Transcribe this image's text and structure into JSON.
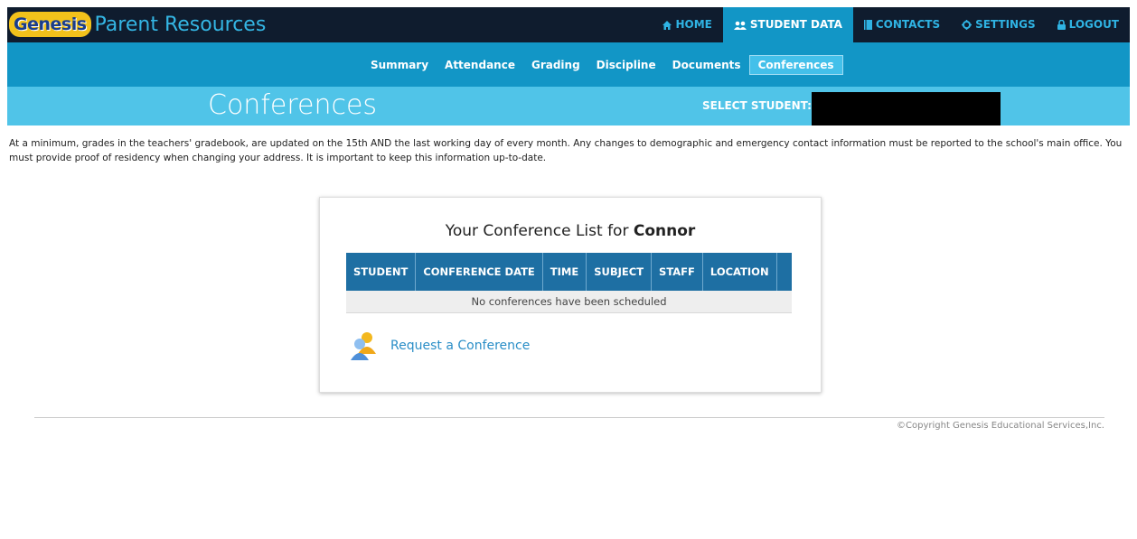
{
  "header": {
    "logo_text": "Genesis",
    "app_title": "Parent Resources",
    "nav": [
      {
        "label": "HOME",
        "icon": "home-icon"
      },
      {
        "label": "STUDENT DATA",
        "icon": "users-icon",
        "active": true
      },
      {
        "label": "CONTACTS",
        "icon": "book-icon"
      },
      {
        "label": "SETTINGS",
        "icon": "gear-icon"
      },
      {
        "label": "LOGOUT",
        "icon": "lock-icon"
      }
    ]
  },
  "subnav": {
    "items": [
      {
        "label": "Summary"
      },
      {
        "label": "Attendance"
      },
      {
        "label": "Grading"
      },
      {
        "label": "Discipline"
      },
      {
        "label": "Documents"
      },
      {
        "label": "Conferences",
        "active": true
      }
    ]
  },
  "page": {
    "title": "Conferences",
    "select_student_label": "SELECT STUDENT:"
  },
  "notice": "At a minimum, grades in the teachers' gradebook, are updated on the 15th AND the last working day of every month. Any changes to demographic and emergency contact information must be reported to the school's main office. You must provide proof of residency when changing your address. It is important to keep this information up-to-date.",
  "conference": {
    "heading_prefix": "Your Conference List for",
    "student_name": "Connor",
    "columns": [
      "STUDENT",
      "CONFERENCE DATE",
      "TIME",
      "SUBJECT",
      "STAFF",
      "LOCATION",
      ""
    ],
    "empty_message": "No conferences have been scheduled",
    "request_label": "Request a Conference"
  },
  "footer": {
    "copyright": "©Copyright Genesis Educational Services,Inc."
  },
  "colors": {
    "topbar": "#0f1c2e",
    "subnav": "#1296c6",
    "band": "#50c4e8",
    "table_header": "#1e6fa3",
    "link": "#2a8ec7"
  }
}
